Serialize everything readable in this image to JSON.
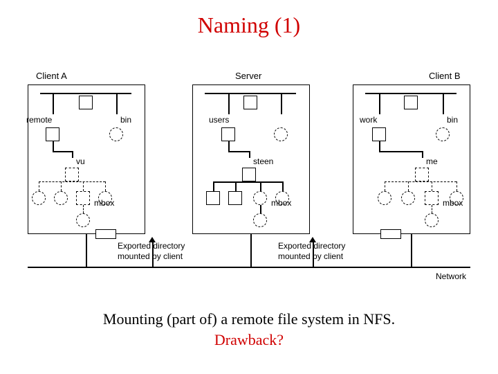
{
  "title": "Naming (1)",
  "caption_line1": "Mounting (part of) a remote file system in NFS.",
  "caption_line2": "Drawback?",
  "hosts": {
    "clientA": "Client A",
    "server": "Server",
    "clientB": "Client B"
  },
  "dirs": {
    "remote": "remote",
    "bin": "bin",
    "vu": "vu",
    "users": "users",
    "steen": "steen",
    "work": "work",
    "me": "me",
    "mbox": "mbox"
  },
  "labels": {
    "export_line1": "Exported directory",
    "export_line2": "mounted by client",
    "network": "Network"
  }
}
